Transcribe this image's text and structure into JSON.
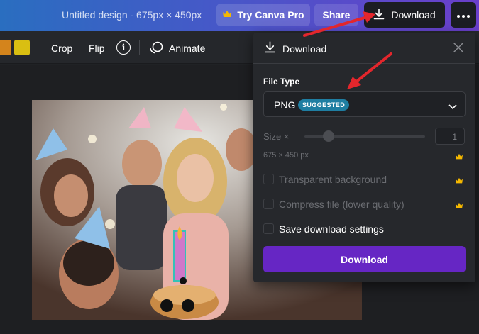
{
  "topbar": {
    "doc_title": "Untitled design - 675px × 450px",
    "try_pro_label": "Try Canva Pro",
    "share_label": "Share",
    "download_label": "Download"
  },
  "toolbar": {
    "crop_label": "Crop",
    "flip_label": "Flip",
    "info_glyph": "i",
    "animate_label": "Animate",
    "swatches": [
      "#d4841c",
      "#d9bf12"
    ]
  },
  "panel": {
    "title": "Download",
    "file_type_label": "File Type",
    "file_type_value": "PNG",
    "suggested_badge": "SUGGESTED",
    "size_label": "Size ×",
    "size_value": "1",
    "size_fraction": 0.2,
    "dimensions": "675 × 450 px",
    "options": [
      {
        "label": "Transparent background",
        "checked": false,
        "pro": true,
        "enabled": false
      },
      {
        "label": "Compress file (lower quality)",
        "checked": false,
        "pro": true,
        "enabled": false
      },
      {
        "label": "Save download settings",
        "checked": false,
        "pro": false,
        "enabled": true
      }
    ],
    "download_button_label": "Download"
  },
  "colors": {
    "accent_purple": "#6626c4",
    "badge_blue": "#1f7ea2",
    "crown_gold": "#f5b800",
    "annotation_red": "#e3262c"
  }
}
